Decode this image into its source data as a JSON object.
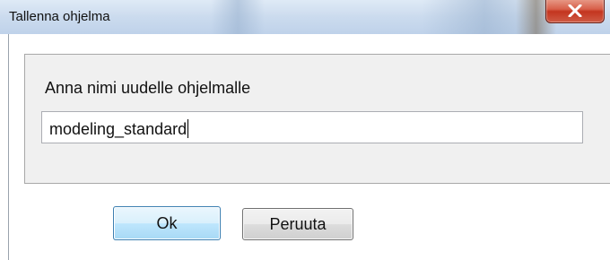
{
  "window": {
    "title": "Tallenna ohjelma",
    "close_icon": "close-icon",
    "close_color": "#c3351f"
  },
  "dialog": {
    "prompt": "Anna nimi uudelle ohjelmalle",
    "name_value": "modeling_standard",
    "ok_label": "Ok",
    "cancel_label": "Peruuta"
  },
  "colors": {
    "titlebar": "#cbdbee",
    "group_background": "#f0f0f0",
    "default_button_border": "#3c7fb1"
  }
}
